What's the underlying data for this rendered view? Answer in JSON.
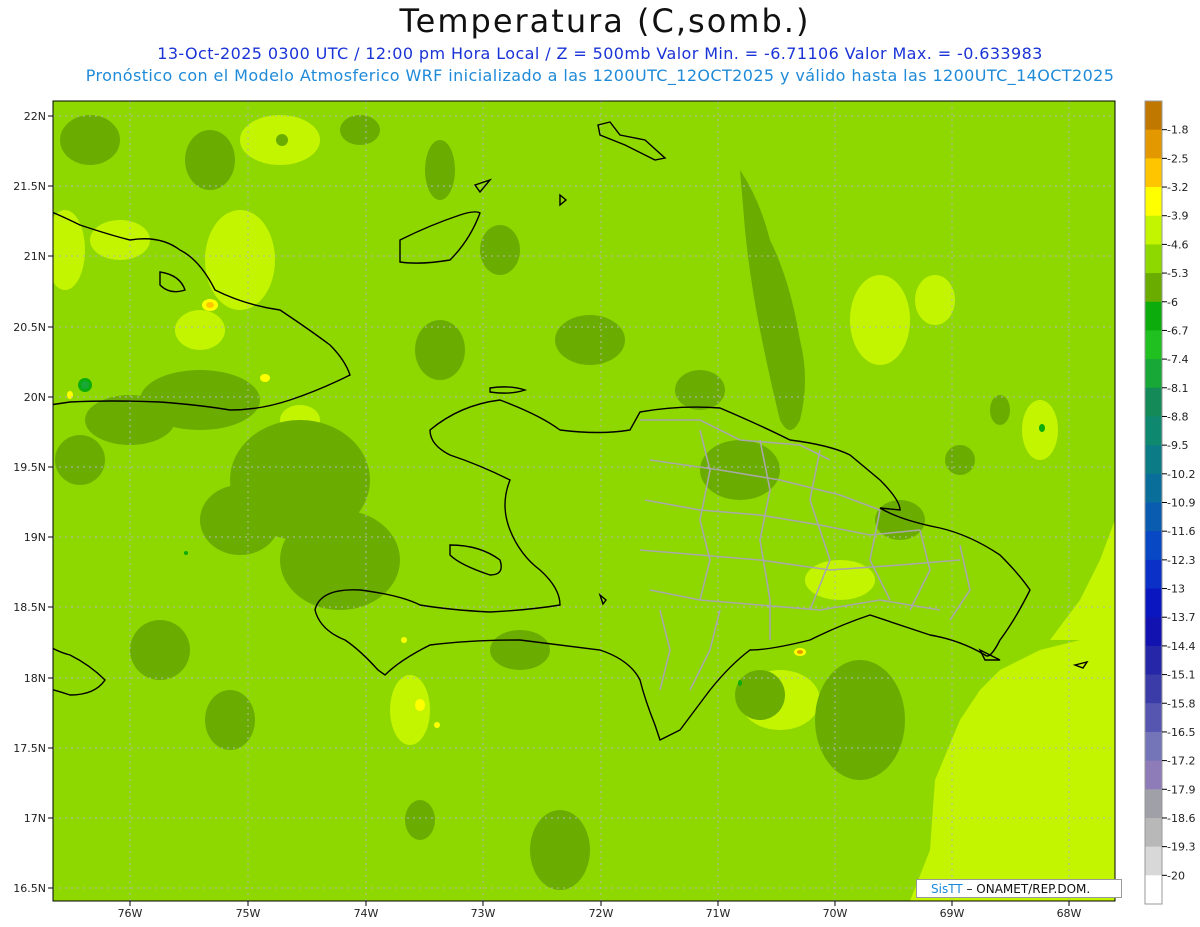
{
  "header": {
    "title": "Temperatura (C,somb.)",
    "line1": "13-Oct-2025  0300 UTC / 12:00 pm Hora Local / Z = 500mb Valor Min. = -6.71106  Valor Max. = -0.633983",
    "line2": "Pronóstico con el Modelo Atmosferico WRF inicializado a las 1200UTC_12OCT2025 y válido hasta las  1200UTC_14OCT2025"
  },
  "axes": {
    "lat_labels": [
      "22N",
      "21.5N",
      "21N",
      "20.5N",
      "20N",
      "19.5N",
      "19N",
      "18.5N",
      "18N",
      "17.5N",
      "17N",
      "16.5N"
    ],
    "lon_labels": [
      "76W",
      "75W",
      "74W",
      "73W",
      "72W",
      "71W",
      "70W",
      "69W",
      "68W"
    ]
  },
  "colorbar": {
    "labels": [
      "-1.8",
      "-2.5",
      "-3.2",
      "-3.9",
      "-4.6",
      "-5.3",
      "-6",
      "-6.7",
      "-7.4",
      "-8.1",
      "-8.8",
      "-9.5",
      "-10.2",
      "-10.9",
      "-11.6",
      "-12.3",
      "-13",
      "-13.7",
      "-14.4",
      "-15.1",
      "-15.8",
      "-16.5",
      "-17.2",
      "-17.9",
      "-18.6",
      "-19.3",
      "-20"
    ],
    "colors": [
      "#c07800",
      "#e49800",
      "#ffc600",
      "#ffff00",
      "#c4f500",
      "#8ed800",
      "#6aad00",
      "#0cac0c",
      "#20c020",
      "#18a838",
      "#138a58",
      "#0f8870",
      "#0b7c86",
      "#0a6e9a",
      "#0a5cb0",
      "#0848c4",
      "#0a30c8",
      "#0a16c0",
      "#1212b0",
      "#2626a8",
      "#3c3ca8",
      "#5656b0",
      "#7474b8",
      "#8e7cb8",
      "#a0a0a8",
      "#b8b8b8",
      "#d8d8d8",
      "#ffffff"
    ]
  },
  "colors": {
    "field_base": "#8ed800",
    "field_warm": "#c4f500",
    "field_cool": "#6aad00",
    "coast": "#000000",
    "provinces": "#aaaaaa"
  },
  "credit": {
    "sis": "SisTT",
    "text": "– ONAMET/REP.DOM."
  }
}
